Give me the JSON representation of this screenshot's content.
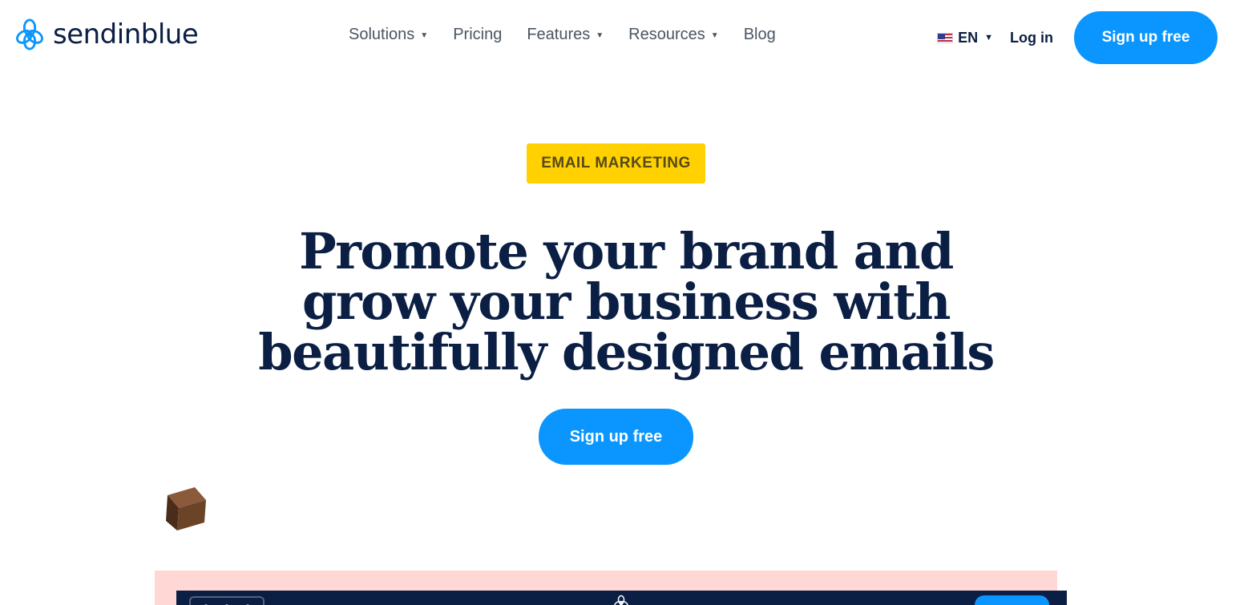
{
  "brand": {
    "name": "sendinblue",
    "color": "#0b96ff",
    "text_color": "#0b1f44"
  },
  "nav": {
    "items": [
      {
        "label": "Solutions",
        "has_dropdown": true
      },
      {
        "label": "Pricing",
        "has_dropdown": false
      },
      {
        "label": "Features",
        "has_dropdown": true
      },
      {
        "label": "Resources",
        "has_dropdown": true
      },
      {
        "label": "Blog",
        "has_dropdown": false
      }
    ]
  },
  "header": {
    "language": {
      "code": "EN",
      "flag": "us-flag-icon"
    },
    "login_label": "Log in",
    "signup_label": "Sign up free"
  },
  "hero": {
    "badge": "EMAIL MARKETING",
    "badge_color": "#ffd100",
    "headline_lines": [
      "Promote your brand and",
      "grow your business with",
      "beautifully designed emails"
    ],
    "cta_label": "Sign up free"
  },
  "preview": {
    "background_color": "#ffd7d4",
    "bar_color": "#0b1f44"
  }
}
